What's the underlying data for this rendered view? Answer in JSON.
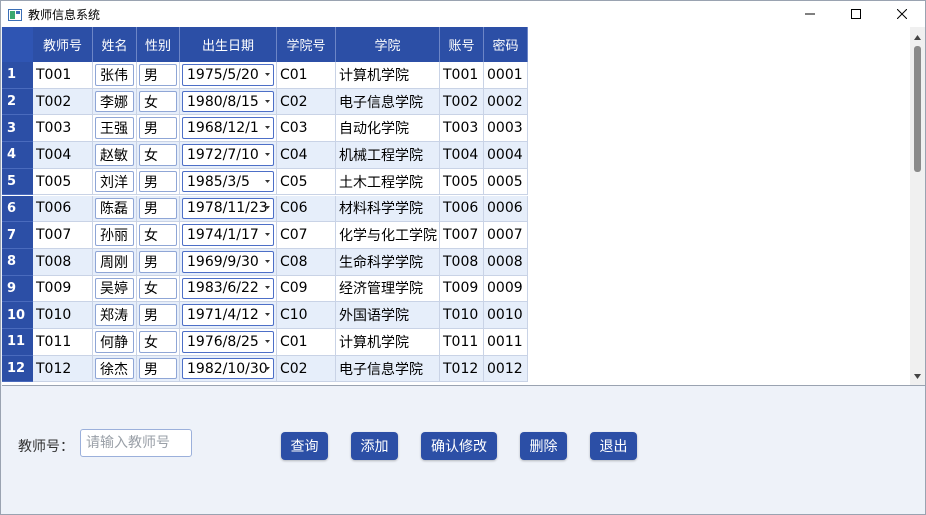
{
  "window": {
    "title": "教师信息系统",
    "controls": [
      "minimize-icon",
      "maximize-icon",
      "close-icon"
    ]
  },
  "table": {
    "columns": [
      "教师号",
      "姓名",
      "性别",
      "出生日期",
      "学院号",
      "学院",
      "账号",
      "密码"
    ],
    "rows": [
      {
        "num": "1",
        "id": "T001",
        "name": "张伟",
        "gender": "男",
        "birth": "1975/5/20",
        "college_id": "C01",
        "college": "计算机学院",
        "account": "T001",
        "password": "0001"
      },
      {
        "num": "2",
        "id": "T002",
        "name": "李娜",
        "gender": "女",
        "birth": "1980/8/15",
        "college_id": "C02",
        "college": "电子信息学院",
        "account": "T002",
        "password": "0002"
      },
      {
        "num": "3",
        "id": "T003",
        "name": "王强",
        "gender": "男",
        "birth": "1968/12/1",
        "college_id": "C03",
        "college": "自动化学院",
        "account": "T003",
        "password": "0003"
      },
      {
        "num": "4",
        "id": "T004",
        "name": "赵敏",
        "gender": "女",
        "birth": "1972/7/10",
        "college_id": "C04",
        "college": "机械工程学院",
        "account": "T004",
        "password": "0004"
      },
      {
        "num": "5",
        "id": "T005",
        "name": "刘洋",
        "gender": "男",
        "birth": "1985/3/5",
        "college_id": "C05",
        "college": "土木工程学院",
        "account": "T005",
        "password": "0005"
      },
      {
        "num": "6",
        "id": "T006",
        "name": "陈磊",
        "gender": "男",
        "birth": "1978/11/23",
        "college_id": "C06",
        "college": "材料科学学院",
        "account": "T006",
        "password": "0006"
      },
      {
        "num": "7",
        "id": "T007",
        "name": "孙丽",
        "gender": "女",
        "birth": "1974/1/17",
        "college_id": "C07",
        "college": "化学与化工学院",
        "account": "T007",
        "password": "0007"
      },
      {
        "num": "8",
        "id": "T008",
        "name": "周刚",
        "gender": "男",
        "birth": "1969/9/30",
        "college_id": "C08",
        "college": "生命科学学院",
        "account": "T008",
        "password": "0008"
      },
      {
        "num": "9",
        "id": "T009",
        "name": "吴婷",
        "gender": "女",
        "birth": "1983/6/22",
        "college_id": "C09",
        "college": "经济管理学院",
        "account": "T009",
        "password": "0009"
      },
      {
        "num": "10",
        "id": "T010",
        "name": "郑涛",
        "gender": "男",
        "birth": "1971/4/12",
        "college_id": "C10",
        "college": "外国语学院",
        "account": "T010",
        "password": "0010"
      },
      {
        "num": "11",
        "id": "T011",
        "name": "何静",
        "gender": "女",
        "birth": "1976/8/25",
        "college_id": "C01",
        "college": "计算机学院",
        "account": "T011",
        "password": "0011"
      },
      {
        "num": "12",
        "id": "T012",
        "name": "徐杰",
        "gender": "男",
        "birth": "1982/10/30",
        "college_id": "C02",
        "college": "电子信息学院",
        "account": "T012",
        "password": "0012"
      }
    ]
  },
  "search": {
    "label": "教师号：",
    "placeholder": "请输入教师号",
    "value": ""
  },
  "buttons": {
    "query": "查询",
    "add": "添加",
    "confirm": "确认修改",
    "delete": "删除",
    "exit": "退出"
  },
  "colors": {
    "header_bg": "#2c4fa6",
    "alt_row_bg": "#e6eefa",
    "button_bg": "#2c4fa6"
  }
}
